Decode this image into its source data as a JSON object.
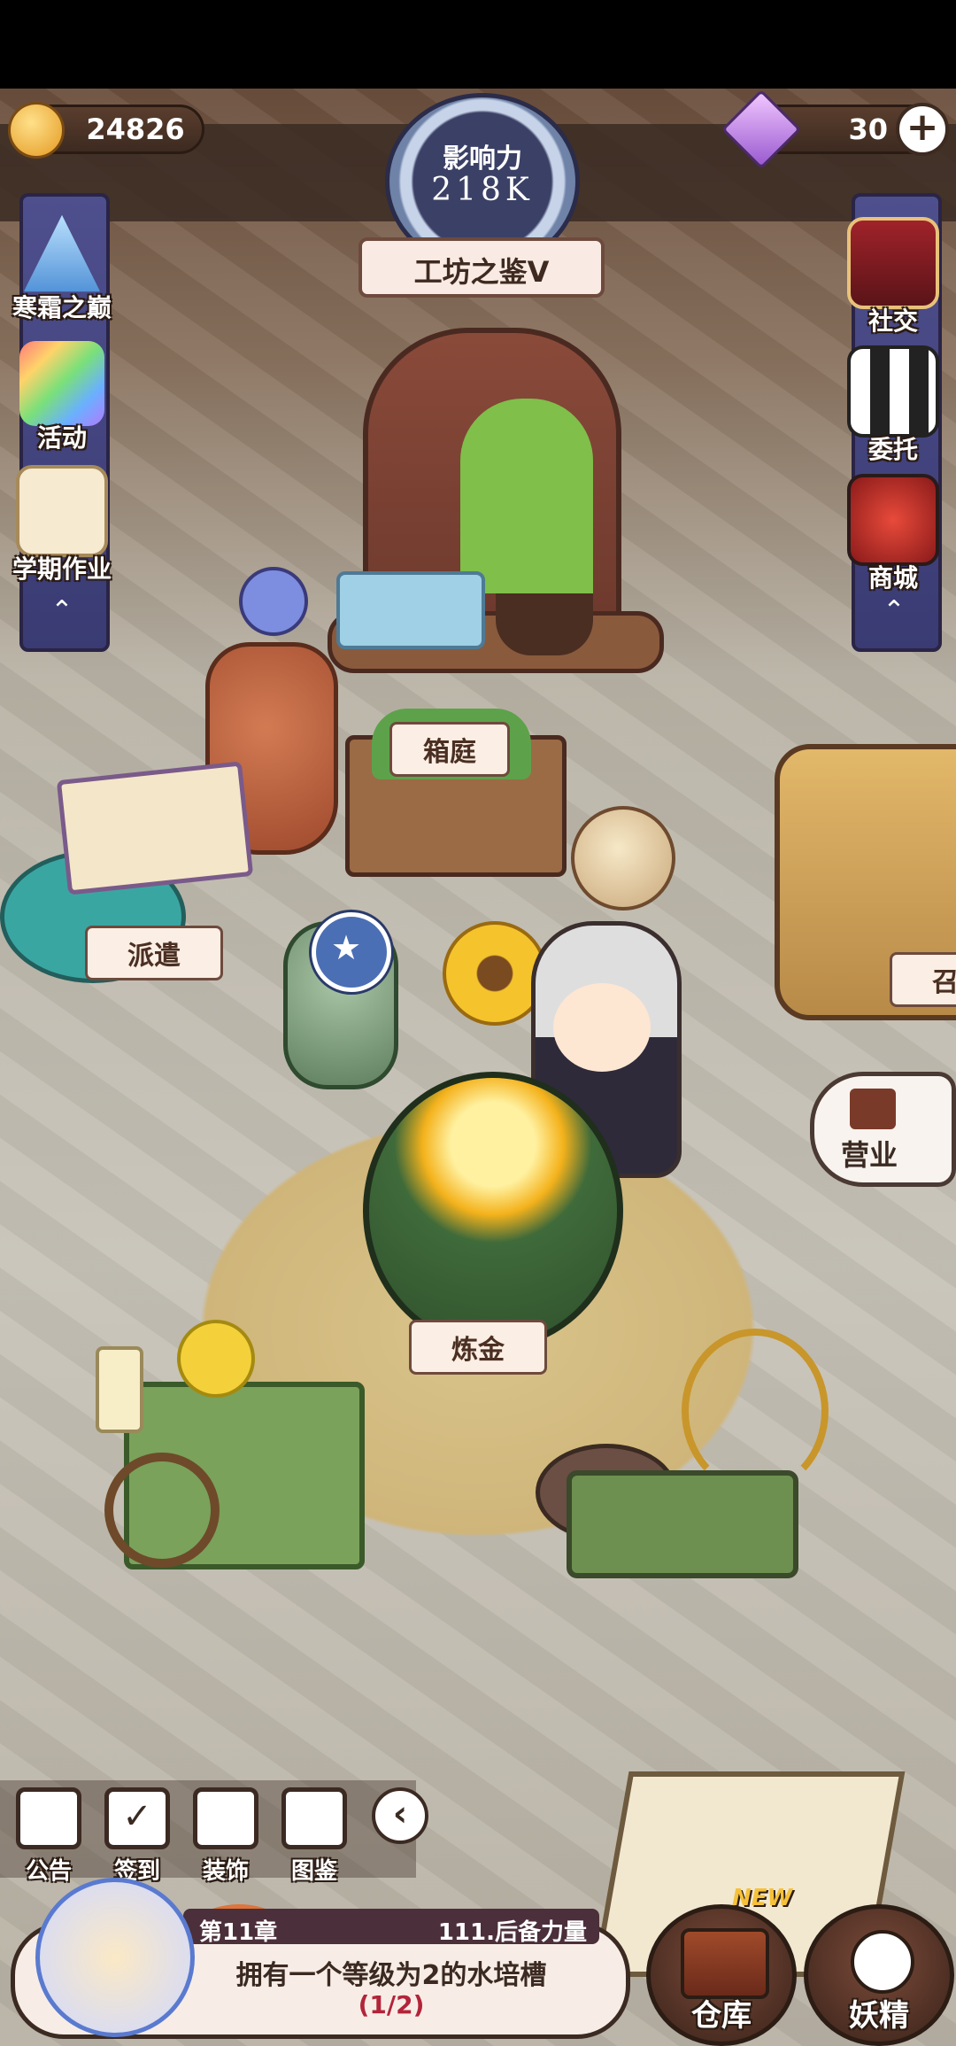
{
  "currency": {
    "gold": "24826",
    "gems": "30"
  },
  "influence": {
    "label": "影响力",
    "value": "218K"
  },
  "workshop_title": "工坊之鉴V",
  "left_menu": [
    {
      "label": "寒霜之巅",
      "icon": "ice-mountain-icon"
    },
    {
      "label": "活动",
      "icon": "rainbow-scroll-icon"
    },
    {
      "label": "学期作业",
      "icon": "scroll-quill-icon"
    }
  ],
  "right_menu": [
    {
      "label": "社交",
      "icon": "birds-icon"
    },
    {
      "label": "委托",
      "icon": "notice-board-icon"
    },
    {
      "label": "商城",
      "icon": "shop-chest-icon"
    }
  ],
  "stations": {
    "planter": "箱庭",
    "dispatch": "派遣",
    "summon": "召",
    "alchemy": "炼金",
    "business": "营业"
  },
  "bottom_bar": [
    {
      "label": "公告",
      "icon": "board-icon"
    },
    {
      "label": "签到",
      "icon": "calendar-check-icon"
    },
    {
      "label": "装饰",
      "icon": "tower-icon"
    },
    {
      "label": "图鉴",
      "icon": "book-icon"
    }
  ],
  "quest": {
    "chapter": "第11章",
    "chapter_name": "111.后备力量",
    "objective": "拥有一个等级为2的水培槽",
    "progress": "(1/2)"
  },
  "warehouse": {
    "label": "仓库",
    "badge": "NEW"
  },
  "fairy": {
    "label": "妖精"
  },
  "colors": {
    "accent_pink": "#f6c6c8",
    "gem_purple": "#c99be0",
    "gold": "#f1b13a",
    "rail_blue": "#45467f"
  }
}
